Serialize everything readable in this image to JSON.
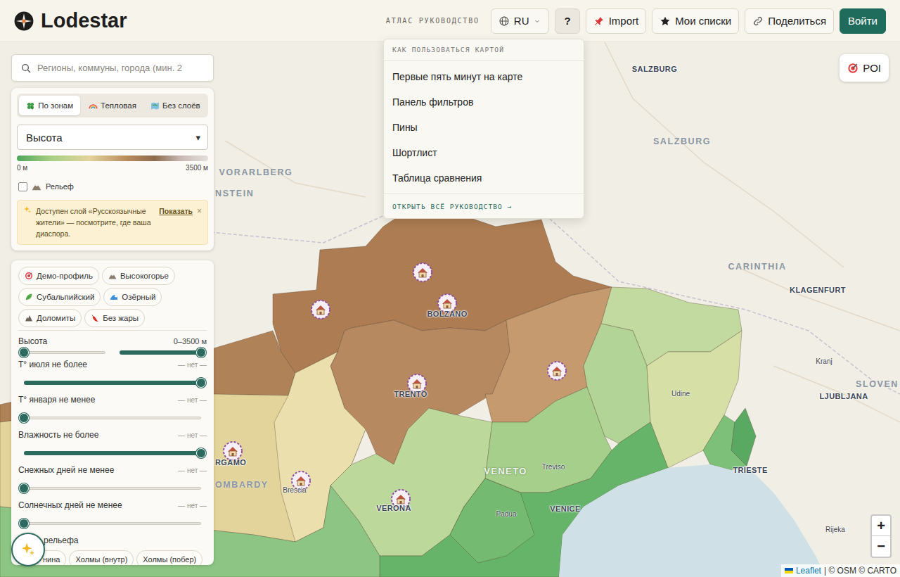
{
  "app": {
    "title": "Lodestar"
  },
  "header": {
    "guide_link": "АТЛАС РУКОВОДСТВО",
    "language": "RU",
    "help": {
      "label": "?",
      "open": true
    },
    "buttons": [
      {
        "label": "Import",
        "kind": "outline"
      },
      {
        "label": "Мои списки",
        "kind": "outline"
      },
      {
        "label": "Поделиться",
        "kind": "outline"
      },
      {
        "label": "Войти",
        "kind": "primary"
      }
    ]
  },
  "help_menu": {
    "title": "КАК ПОЛЬЗОВАТЬСЯ КАРТОЙ",
    "items": [
      "Первые пять минут на карте",
      "Панель фильтров",
      "Пины",
      "Шортлист",
      "Таблица сравнения"
    ],
    "footer": "ОТКРЫТЬ ВСЁ РУКОВОДСТВО →"
  },
  "search": {
    "placeholder": "Регионы, коммуны, города (мин. 2"
  },
  "layer_tabs": [
    {
      "label": "По зонам",
      "selected": true
    },
    {
      "label": "Тепловая",
      "selected": false
    },
    {
      "label": "Без слоёв",
      "selected": false
    }
  ],
  "metric_select": {
    "value": "Высота",
    "arrow": "▾"
  },
  "legend": {
    "min": "0 м",
    "max": "3500 м"
  },
  "relief": {
    "label": "Рельеф",
    "checked": false
  },
  "notice": {
    "text": "Доступен слой «Русскоязычные жители» — посмотрите, где ваша диаспора.",
    "action": "Показать",
    "close": "×"
  },
  "presets": [
    {
      "label": "Демо-профиль"
    },
    {
      "label": "Высокогорье"
    },
    {
      "label": "Субальпийский"
    },
    {
      "label": "Озёрный"
    },
    {
      "label": "Доломиты"
    },
    {
      "label": "Без жары"
    }
  ],
  "filters": [
    {
      "label": "Высота",
      "reading": "0–3500 м",
      "kind": "range",
      "low": 0,
      "high": 1
    },
    {
      "label": "T° июля не более",
      "reading": "— нет —",
      "kind": "single",
      "level": 1
    },
    {
      "label": "T° января не менее",
      "reading": "— нет —",
      "kind": "single",
      "level": 0
    },
    {
      "label": "Влажность не более",
      "reading": "— нет —",
      "kind": "single",
      "level": 1
    },
    {
      "label": "Снежных дней не менее",
      "reading": "— нет —",
      "kind": "single",
      "level": 0
    },
    {
      "label": "Солнечных дней не менее",
      "reading": "— нет —",
      "kind": "single",
      "level": 0
    }
  ],
  "relief_type": {
    "label": "рельефа",
    "options": [
      "нина",
      "Холмы (внутр)",
      "Холмы (побер)"
    ]
  },
  "poi_button": {
    "label": "POI"
  },
  "zoom": {
    "in": "+",
    "out": "−"
  },
  "attribution": {
    "link": "Leaflet",
    "text": "| © OSM © CARTO"
  },
  "map": {
    "labels": [
      {
        "text": "SALZBURG",
        "kind": "city"
      },
      {
        "text": "SALZBURG",
        "kind": "region"
      },
      {
        "text": "VORARLBERG",
        "kind": "region"
      },
      {
        "text": "NSTEIN",
        "kind": "region"
      },
      {
        "text": "CARINTHIA",
        "kind": "region"
      },
      {
        "text": "KLAGENFURT",
        "kind": "city"
      },
      {
        "text": "Kranj",
        "kind": "town"
      },
      {
        "text": "SLOVEN",
        "kind": "region"
      },
      {
        "text": "LJUBLJANA",
        "kind": "city"
      },
      {
        "text": "Udine",
        "kind": "town"
      },
      {
        "text": "TRIESTE",
        "kind": "city"
      },
      {
        "text": "Rijeka",
        "kind": "town"
      },
      {
        "text": "VENETO",
        "kind": "zone"
      },
      {
        "text": "Treviso",
        "kind": "town"
      },
      {
        "text": "VENICE",
        "kind": "city"
      },
      {
        "text": "Padua",
        "kind": "town"
      },
      {
        "text": "VERONA",
        "kind": "city"
      },
      {
        "text": "BOLZANO",
        "kind": "city"
      },
      {
        "text": "TRENTO",
        "kind": "city"
      },
      {
        "text": "RGAMO",
        "kind": "city"
      },
      {
        "text": "OMBARDY",
        "kind": "region"
      },
      {
        "text": "Brescia",
        "kind": "town"
      }
    ],
    "regions": [
      {
        "color": "#b08258"
      },
      {
        "color": "#ad7c52"
      },
      {
        "color": "#b68961"
      },
      {
        "color": "#c49a6e"
      },
      {
        "color": "#e2d49a"
      },
      {
        "color": "#ebdfae"
      },
      {
        "color": "#bcd89b"
      },
      {
        "color": "#a5cf8b"
      },
      {
        "color": "#c2daa0"
      },
      {
        "color": "#b2d497"
      },
      {
        "color": "#d5dfa6"
      },
      {
        "color": "#66b46a"
      },
      {
        "color": "#8cc584"
      },
      {
        "color": "#74ba70"
      },
      {
        "color": "#7cc07a"
      },
      {
        "color": "#5aa962"
      }
    ]
  }
}
